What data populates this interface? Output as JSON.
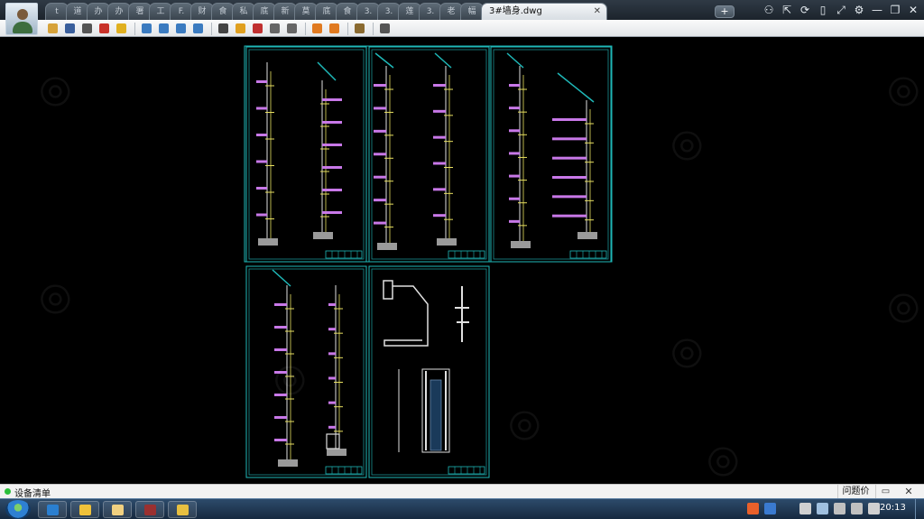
{
  "tabs": [
    {
      "label": "t",
      "active": false
    },
    {
      "label": "道",
      "active": false
    },
    {
      "label": "办",
      "active": false
    },
    {
      "label": "办",
      "active": false
    },
    {
      "label": "署",
      "active": false
    },
    {
      "label": "工",
      "active": false
    },
    {
      "label": "F.",
      "active": false
    },
    {
      "label": "财",
      "active": false
    },
    {
      "label": "食",
      "active": false
    },
    {
      "label": "私",
      "active": false
    },
    {
      "label": "底",
      "active": false
    },
    {
      "label": "新",
      "active": false
    },
    {
      "label": "莫",
      "active": false
    },
    {
      "label": "底",
      "active": false
    },
    {
      "label": "食",
      "active": false
    },
    {
      "label": "3.",
      "active": false
    },
    {
      "label": "3.",
      "active": false
    },
    {
      "label": "莲",
      "active": false
    },
    {
      "label": "3.",
      "active": false
    },
    {
      "label": "老",
      "active": false
    },
    {
      "label": "幅",
      "active": false
    },
    {
      "label": "3#墙身.dwg",
      "active": true
    }
  ],
  "new_tab_label": "+",
  "active_tab_close": "✕",
  "window_controls": {
    "users_icon": "users-icon",
    "share_icon": "share-icon",
    "sync_icon": "sync-icon",
    "phone_icon": "phone-icon",
    "fullscreen_icon": "fullscreen-icon",
    "settings_icon": "gear-icon",
    "minimize": "—",
    "restore": "❐",
    "close": "✕"
  },
  "toolbar": {
    "groups": [
      [
        "open-icon",
        "save-icon",
        "print-icon",
        "pdf-icon",
        "lock-icon"
      ],
      [
        "pan-icon",
        "zoom-in-icon",
        "zoom-out-icon",
        "zoom-window-icon"
      ],
      [
        "text-icon",
        "pencil-icon",
        "markup-pen-icon",
        "undo-icon",
        "redo-icon"
      ],
      [
        "measure-icon",
        "dimension-icon"
      ],
      [
        "layers-icon"
      ],
      [
        "export-icon"
      ]
    ]
  },
  "status": {
    "text": "设备清单",
    "feedback_label": "问题价",
    "chat_icon": "chat-icon",
    "close_label": "✕"
  },
  "taskbar": {
    "clock": "20:13",
    "tasks": [
      "ie-icon",
      "qq-icon",
      "explorer-icon",
      "winrar-icon",
      "cad-viewer-icon"
    ],
    "tray": [
      "sogou-icon",
      "help-icon",
      "flag-icon",
      "network-icon",
      "battery-icon",
      "signal-icon",
      "volume-icon"
    ]
  },
  "colors": {
    "accent_cyan": "#1fb8b8",
    "canvas_bg": "#000000",
    "purple_slab": "#c878e8",
    "yellow_line": "#e8e060"
  }
}
